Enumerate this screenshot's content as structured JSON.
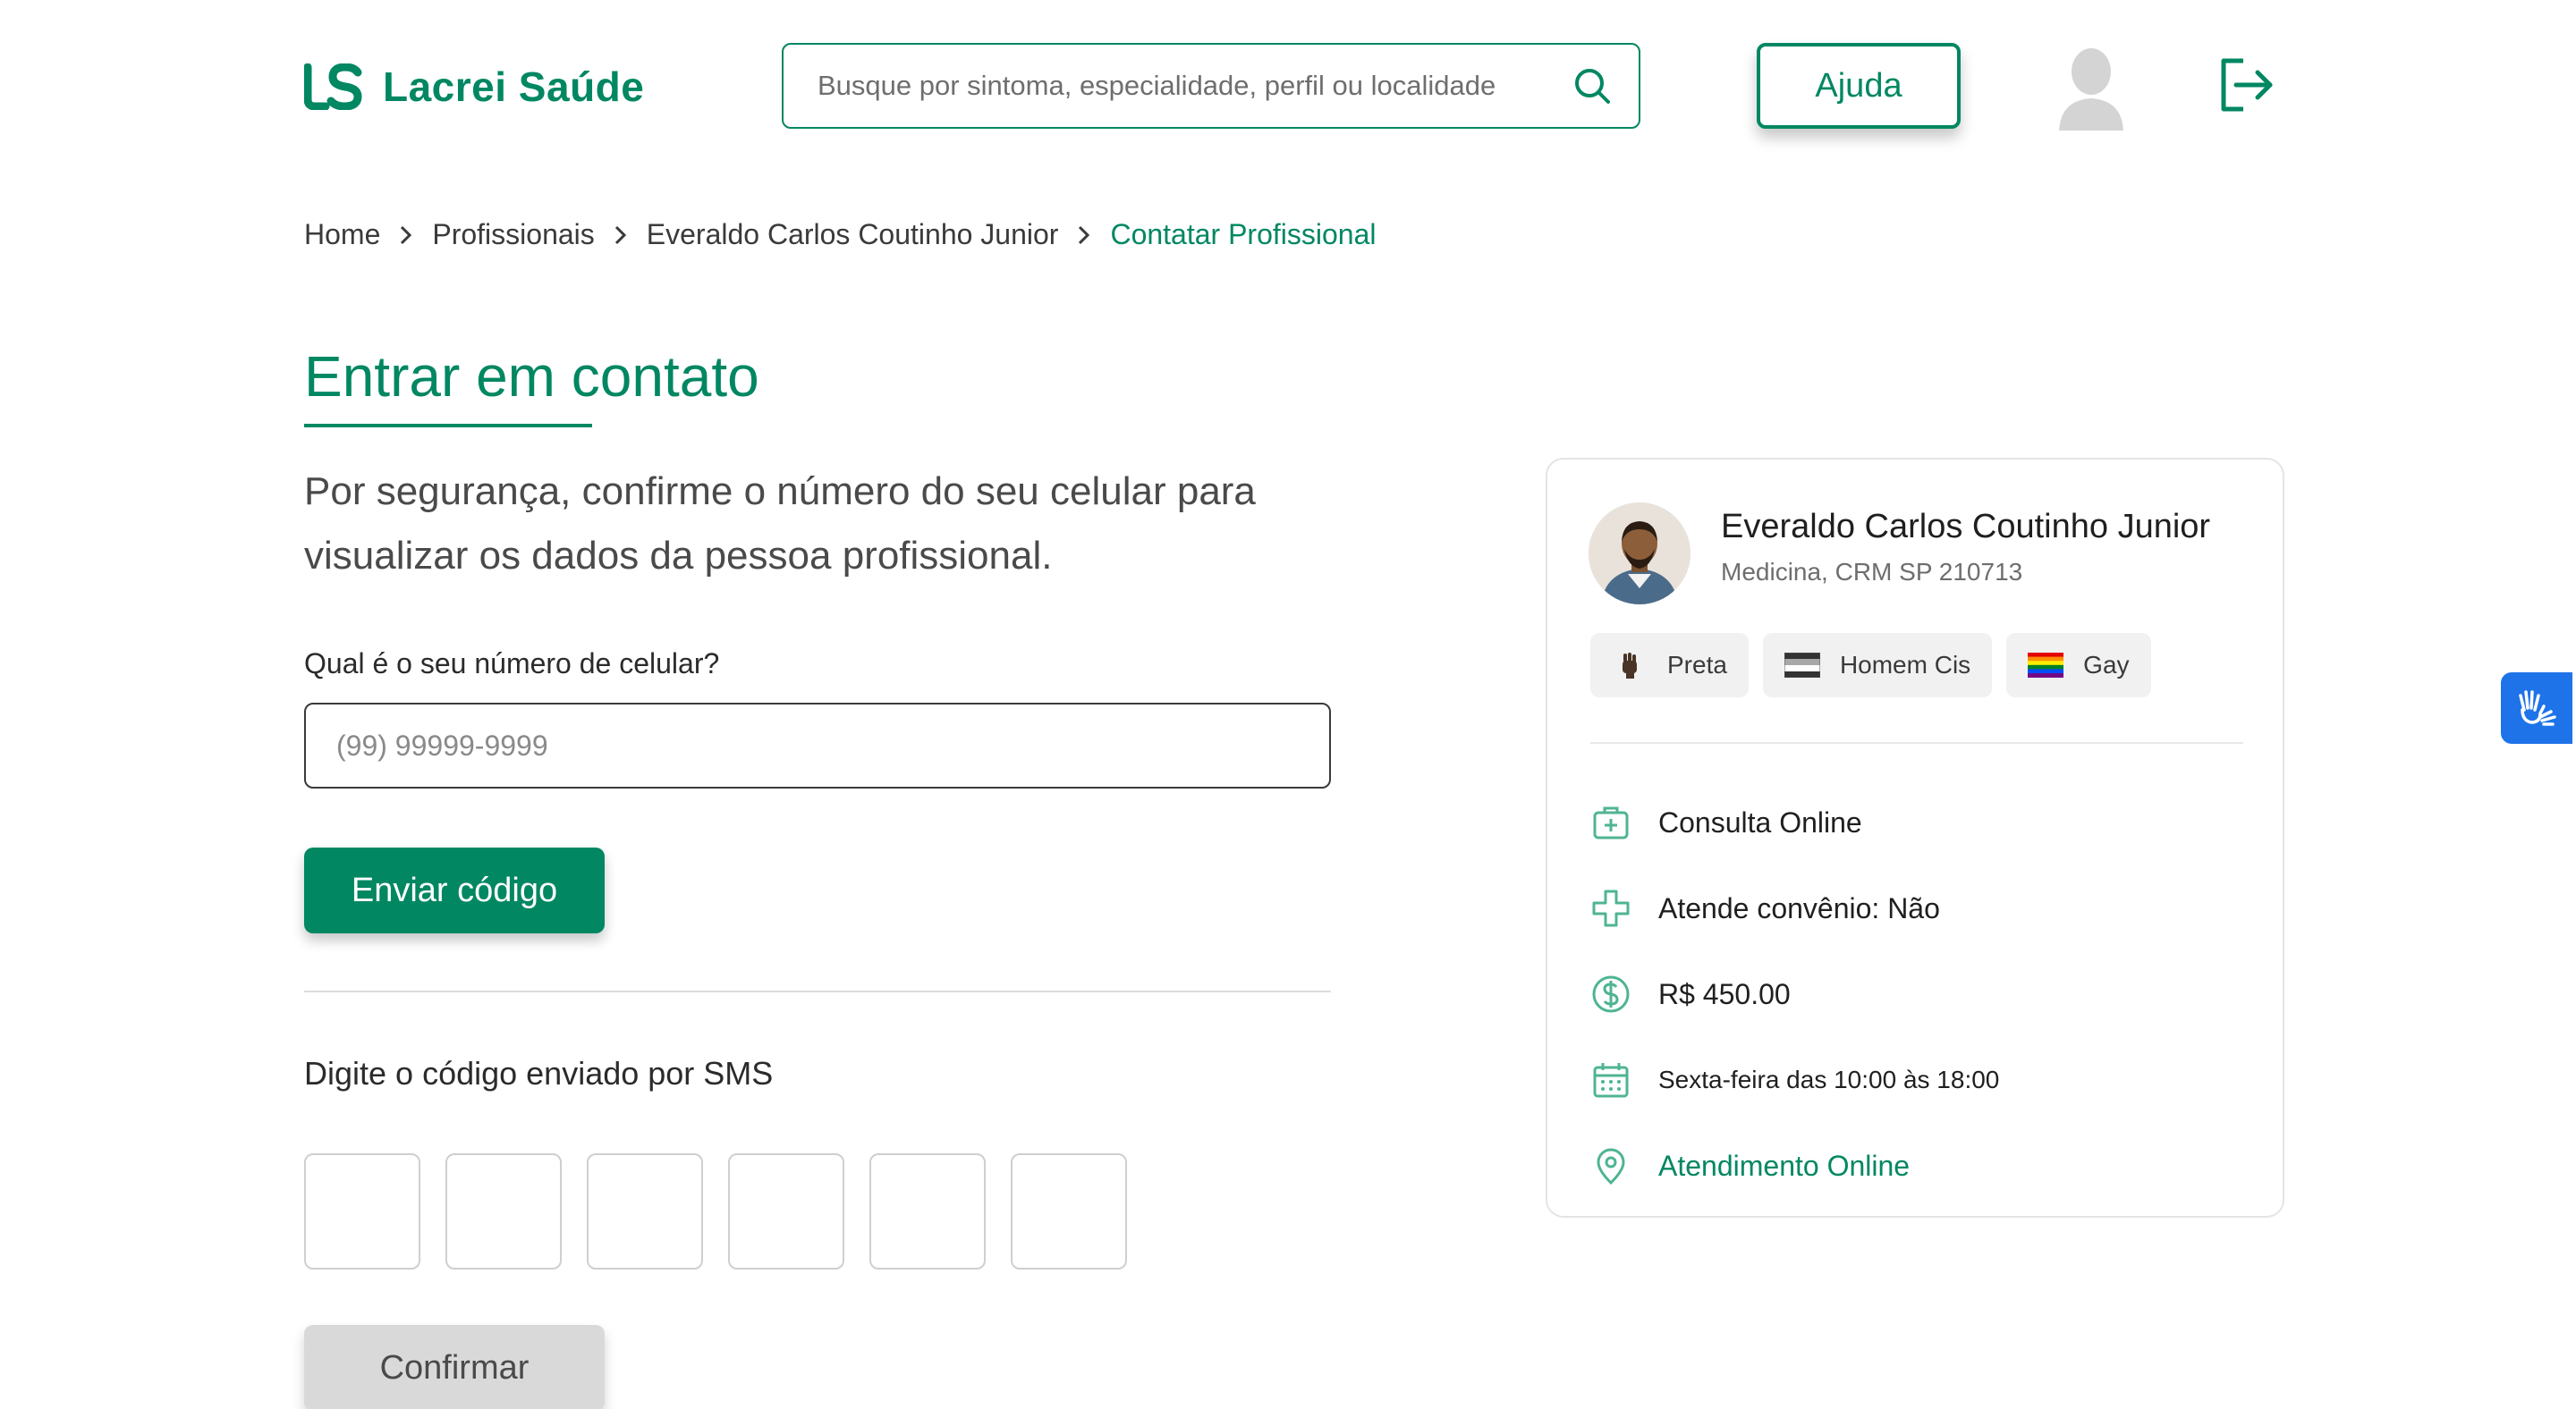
{
  "header": {
    "logo_text": "Lacrei Saúde",
    "search_placeholder": "Busque por sintoma, especialidade, perfil ou localidade",
    "help_label": "Ajuda"
  },
  "breadcrumb": {
    "items": [
      "Home",
      "Profissionais",
      "Everaldo Carlos Coutinho Junior"
    ],
    "current": "Contatar Profissional"
  },
  "form": {
    "title": "Entrar em contato",
    "intro": "Por segurança, confirme o número do seu celular para visualizar os dados da pessoa profissional.",
    "phone_label": "Qual é o seu número de celular?",
    "phone_placeholder": "(99) 99999-9999",
    "phone_value": "",
    "send_label": "Enviar código",
    "sms_label": "Digite o código enviado por SMS",
    "code_digits": [
      "",
      "",
      "",
      "",
      "",
      ""
    ],
    "confirm_label": "Confirmar"
  },
  "profile": {
    "name": "Everaldo Carlos Coutinho Junior",
    "specialty": "Medicina, CRM SP 210713",
    "tags": [
      {
        "label": "Preta",
        "icon": "raised-fist-icon"
      },
      {
        "label": "Homem Cis",
        "icon": "flag-icon"
      },
      {
        "label": "Gay",
        "icon": "rainbow-flag-icon"
      }
    ],
    "info": {
      "consult": "Consulta Online",
      "insurance": "Atende convênio: Não",
      "price": "R$ 450.00",
      "schedule": "Sexta-feira das 10:00 às 18:00",
      "location": "Atendimento Online"
    }
  },
  "colors": {
    "brand": "#018762",
    "accessibility": "#1e73e8"
  }
}
